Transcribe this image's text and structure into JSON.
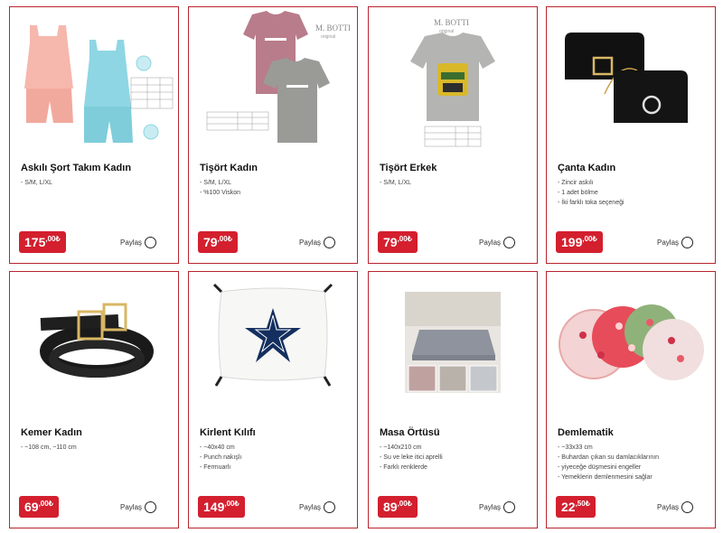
{
  "products": [
    {
      "title": "Askılı Şort Takım Kadın",
      "features": [
        "- S/M, L/XL"
      ],
      "price_main": "175",
      "price_sup": ",00₺",
      "share": "Paylaş"
    },
    {
      "title": "Tişört Kadın",
      "features": [
        "- S/M, L/XL",
        "- %100 Viskon"
      ],
      "price_main": "79",
      "price_sup": ",00₺",
      "share": "Paylaş"
    },
    {
      "title": "Tişört Erkek",
      "features": [
        "- S/M, L/XL"
      ],
      "price_main": "79",
      "price_sup": ",00₺",
      "share": "Paylaş"
    },
    {
      "title": "Çanta Kadın",
      "features": [
        "- Zincir askılı",
        "- 1 adet bölme",
        "- İki farklı toka seçeneği"
      ],
      "price_main": "199",
      "price_sup": ",00₺",
      "share": "Paylaş"
    },
    {
      "title": "Kemer Kadın",
      "features": [
        "- ~108 cm, ~110 cm"
      ],
      "price_main": "69",
      "price_sup": ",00₺",
      "share": "Paylaş"
    },
    {
      "title": "Kirlent Kılıfı",
      "features": [
        "- ~40x40 cm",
        "- Punch nakışlı",
        "- Fermuarlı"
      ],
      "price_main": "149",
      "price_sup": ",00₺",
      "share": "Paylaş"
    },
    {
      "title": "Masa Örtüsü",
      "features": [
        "- ~140x210 cm",
        "- Su ve leke itici aprelli",
        "- Farklı renklerde"
      ],
      "price_main": "89",
      "price_sup": ",00₺",
      "share": "Paylaş"
    },
    {
      "title": "Demlematik",
      "features": [
        "- ~33x33 cm",
        "- Buhardan çıkan su damlacıklarının",
        "- yiyeceğe düşmesini engeller",
        "- Yemeklerin demlenmesini sağlar"
      ],
      "price_main": "22",
      "price_sup": ",50₺",
      "share": "Paylaş"
    }
  ],
  "image_text": {
    "brand_women": "M. BOTTI",
    "brand_women_sub": "original",
    "brand_men": "M. BOTTI",
    "brand_men_sub": "original"
  },
  "colors": {
    "accent": "#d31f2e",
    "border": "#b9252f"
  }
}
